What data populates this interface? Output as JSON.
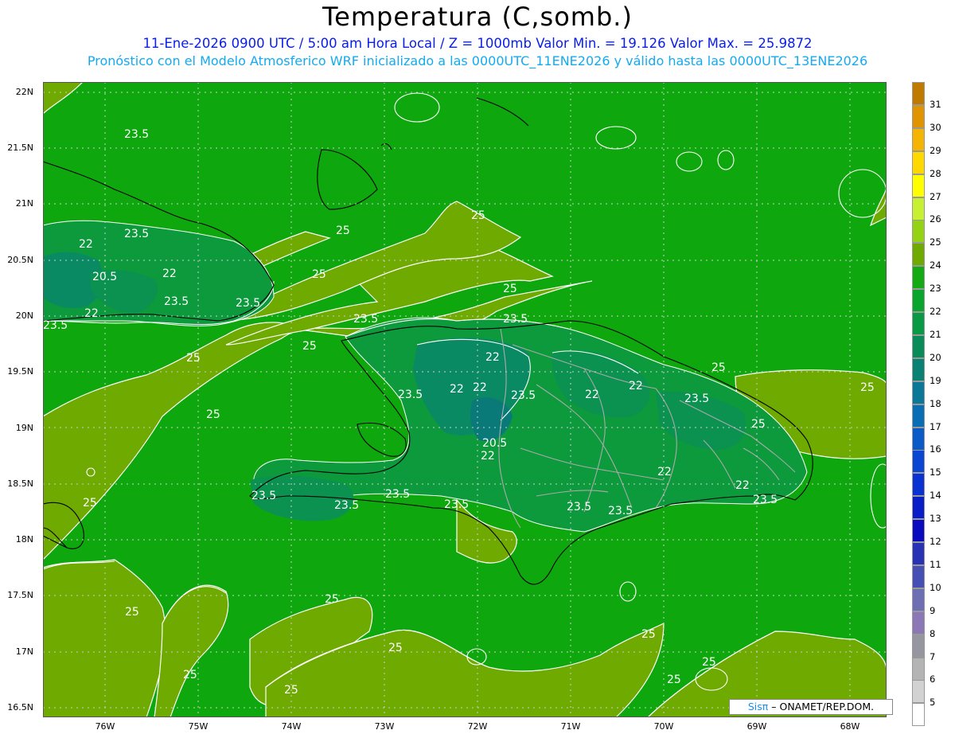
{
  "title": "Temperatura (C,somb.)",
  "subtitle1": "11-Ene-2026  0900 UTC / 5:00 am Hora Local / Z = 1000mb     Valor Min. = 19.126  Valor Max. = 25.9872",
  "subtitle2": "Pronóstico con el Modelo Atmosferico WRF inicializado a las 0000UTC_11ENE2026 y válido hasta las  0000UTC_13ENE2026",
  "lat_labels": [
    "22N",
    "21.5N",
    "21N",
    "20.5N",
    "20N",
    "19.5N",
    "19N",
    "18.5N",
    "18N",
    "17.5N",
    "17N",
    "16.5N"
  ],
  "lon_labels": [
    "76W",
    "75W",
    "74W",
    "73W",
    "72W",
    "71W",
    "70W",
    "69W",
    "68W"
  ],
  "colorbar": {
    "labels": [
      "31",
      "30",
      "29",
      "28",
      "27",
      "26",
      "25",
      "24",
      "23",
      "22",
      "21",
      "20",
      "19",
      "18",
      "17",
      "16",
      "15",
      "14",
      "13",
      "12",
      "11",
      "10",
      "9",
      "8",
      "7",
      "6",
      "5"
    ],
    "colors": [
      "#c07a00",
      "#e09400",
      "#f5b400",
      "#ffd800",
      "#ffff00",
      "#c8f032",
      "#96d214",
      "#6eaa00",
      "#14aa14",
      "#0aa52d",
      "#0a9a46",
      "#0a8c5a",
      "#0a8273",
      "#0a7896",
      "#0a6eb4",
      "#0a5ac8",
      "#0a46d2",
      "#0a32d2",
      "#0a1ec8",
      "#0a0abe",
      "#2832b4",
      "#4650b4",
      "#6e6eb4",
      "#8c78b4",
      "#9696a0",
      "#b4b4b4",
      "#d2d2d2"
    ],
    "bottom_color": "#ffffff"
  },
  "contour_labels": [
    "23.5",
    "25",
    "22",
    "20.5"
  ],
  "credit": {
    "logo": "Sisπ",
    "text": " – ONAMET/REP.DOM."
  }
}
